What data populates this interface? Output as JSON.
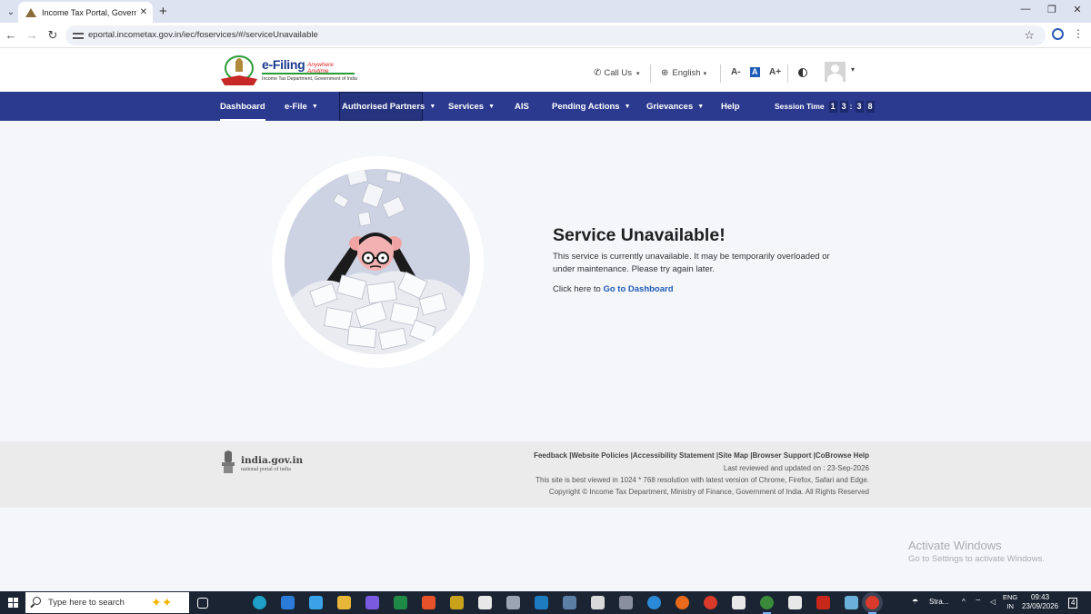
{
  "browser": {
    "tab_title": "Income Tax Portal, Government",
    "url": "eportal.incometax.gov.in/iec/foservices/#/serviceUnavailable"
  },
  "header": {
    "logo_main": "e-Filing",
    "logo_tagline": "Anywhere Anytime",
    "logo_sub": "Income Tax Department, Government of India",
    "call_us": "Call Us",
    "language": "English",
    "font_decrease": "A-",
    "font_default": "A",
    "font_increase": "A+"
  },
  "nav": {
    "items": [
      {
        "label": "Dashboard"
      },
      {
        "label": "e-File"
      },
      {
        "label": "Authorised Partners"
      },
      {
        "label": "Services"
      },
      {
        "label": "AIS"
      },
      {
        "label": "Pending Actions"
      },
      {
        "label": "Grievances"
      },
      {
        "label": "Help"
      }
    ],
    "session_label": "Session Time",
    "session_digits": [
      "1",
      "3",
      "3",
      "8"
    ]
  },
  "error": {
    "title": "Service Unavailable!",
    "message": "This service is currently unavailable. It may be temporarily overloaded or under maintenance. Please try again later.",
    "link_prefix": "Click here to",
    "link_text": "Go to Dashboard"
  },
  "footer": {
    "portal_name": "india.gov.in",
    "portal_sub": "national portal of india",
    "links": "Feedback |Website Policies |Accessibility Statement |Site Map |Browser Support |CoBrowse Help",
    "last_reviewed": "Last reviewed and updated on : 23-Sep-2026",
    "best_viewed": "This site is best viewed in 1024 * 768 resolution with latest version of Chrome, Firefox, Safari and Edge.",
    "copyright": "Copyright © Income Tax Department, Ministry of Finance, Government of India. All Rights Reserved"
  },
  "watermark": {
    "line1": "Activate Windows",
    "line2": "Go to Settings to activate Windows."
  },
  "taskbar": {
    "search_placeholder": "Type here to search",
    "weather": "Stra...",
    "lang_line1": "ENG",
    "lang_line2": "IN",
    "time": "09:43",
    "date": "23/09/2026",
    "notification_count": "4"
  },
  "colors": {
    "navbar": "#2b3a8f",
    "link": "#1f5cb8",
    "footer_bg": "#ebebeb"
  }
}
